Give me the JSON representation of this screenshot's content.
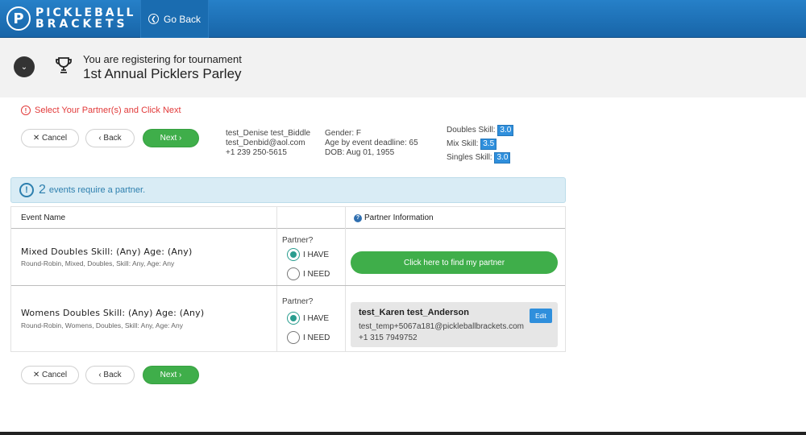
{
  "header": {
    "logo_glyph": "P",
    "logo_line1": "PICKLEBALL",
    "logo_line2": "BRACKETS",
    "go_back_label": "Go Back"
  },
  "tournament": {
    "registering_text": "You are registering for tournament",
    "name": "1st Annual Picklers Parley"
  },
  "notice_text": "Select Your Partner(s) and Click Next",
  "actions": {
    "cancel_label": "✕ Cancel",
    "back_label": "‹ Back",
    "next_label": "Next ›"
  },
  "player": {
    "name": "test_Denise test_Biddle",
    "email": "test_Denbid@aol.com",
    "phone": "+1 239 250-5615",
    "gender": "Gender: F",
    "age_deadline": "Age by event deadline: 65",
    "dob": "DOB: Aug 01, 1955",
    "doubles_label": "Doubles Skill:",
    "doubles_value": "3.0",
    "mix_label": "Mix Skill:",
    "mix_value": "3.5",
    "singles_label": "Singles Skill:",
    "singles_value": "3.0"
  },
  "alert": {
    "count": "2",
    "text": "events require a partner."
  },
  "table": {
    "col_event": "Event Name",
    "col_partner": "Partner Information",
    "rows": [
      {
        "name": "Mixed Doubles Skill: (Any) Age: (Any)",
        "details": "Round-Robin, Mixed, Doubles, Skill: Any, Age: Any",
        "partner_label": "Partner?",
        "opt_have": "I HAVE",
        "opt_need": "I NEED",
        "find_label": "Click here to find my partner"
      },
      {
        "name": "Womens Doubles Skill: (Any) Age: (Any)",
        "details": "Round-Robin, Womens, Doubles, Skill: Any, Age: Any",
        "partner_label": "Partner?",
        "opt_have": "I HAVE",
        "opt_need": "I NEED",
        "partner_name": "test_Karen test_Anderson",
        "partner_email": "test_temp+5067a181@pickleballbrackets.com",
        "partner_phone": "+1 315 7949752",
        "edit_label": "Edit"
      }
    ]
  },
  "colors": {
    "header_blue": "#1d6fb5",
    "next_green": "#3fae4a",
    "notice_red": "#e23a3a",
    "skill_blue": "#2f8fdc"
  }
}
